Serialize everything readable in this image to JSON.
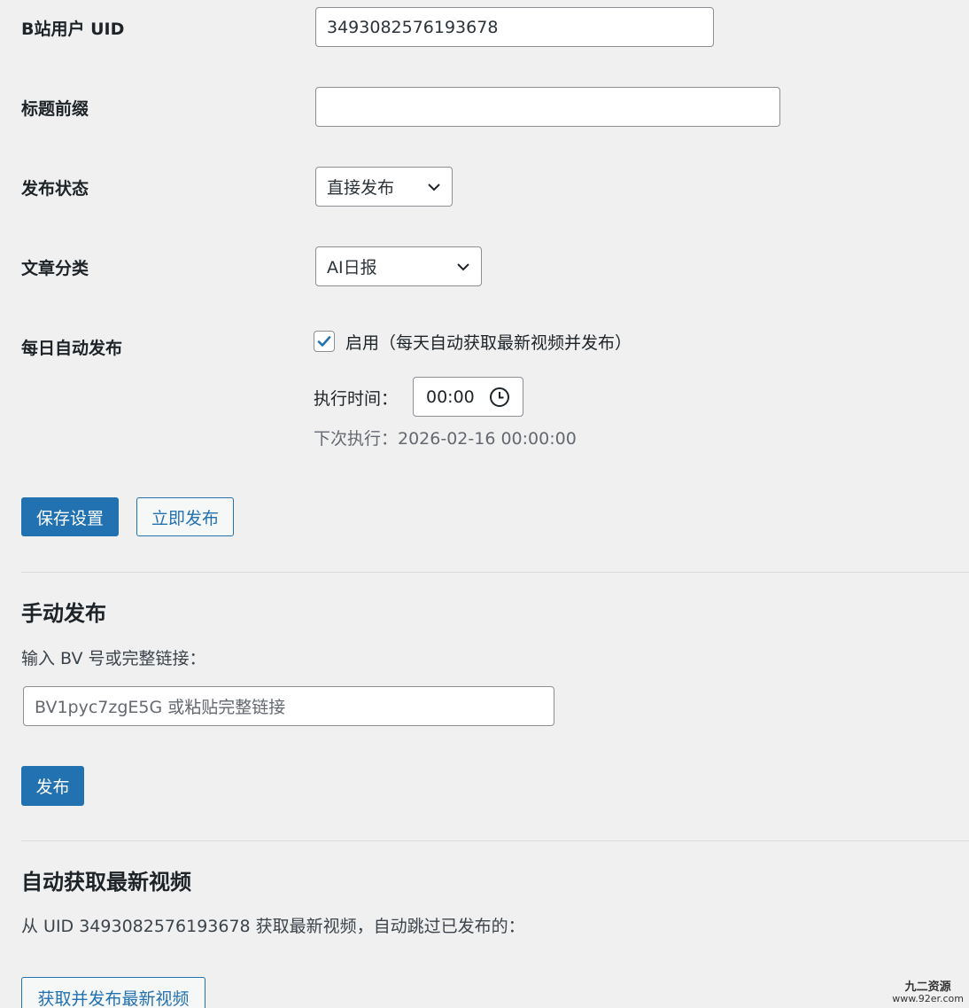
{
  "form": {
    "uid": {
      "label": "B站用户 UID",
      "value": "3493082576193678"
    },
    "title_prefix": {
      "label": "标题前缀",
      "value": ""
    },
    "publish_status": {
      "label": "发布状态",
      "selected": "直接发布"
    },
    "category": {
      "label": "文章分类",
      "selected": "AI日报"
    },
    "daily_auto": {
      "label": "每日自动发布",
      "checked": true,
      "checkbox_label": "启用（每天自动获取最新视频并发布）",
      "time_label": "执行时间：",
      "time_value": "00:00",
      "next_run": "下次执行：2026-02-16 00:00:00"
    },
    "save_button": "保存设置",
    "publish_now_button": "立即发布"
  },
  "manual": {
    "title": "手动发布",
    "input_label": "输入 BV 号或完整链接：",
    "input_placeholder": "BV1pyc7zgE5G 或粘贴完整链接",
    "publish_button": "发布"
  },
  "auto_fetch": {
    "title": "自动获取最新视频",
    "desc": "从 UID 3493082576193678 获取最新视频，自动跳过已发布的：",
    "button": "获取并发布最新视频"
  },
  "watermark": {
    "line1": "九二资源",
    "line2": "www.92er.com"
  },
  "colors": {
    "primary": "#2271b1",
    "background": "#f0f0f1",
    "muted_text": "#646970"
  },
  "icons": {
    "select_arrow": "chevron-down-icon",
    "time": "clock-icon",
    "checkbox": "check-icon"
  }
}
